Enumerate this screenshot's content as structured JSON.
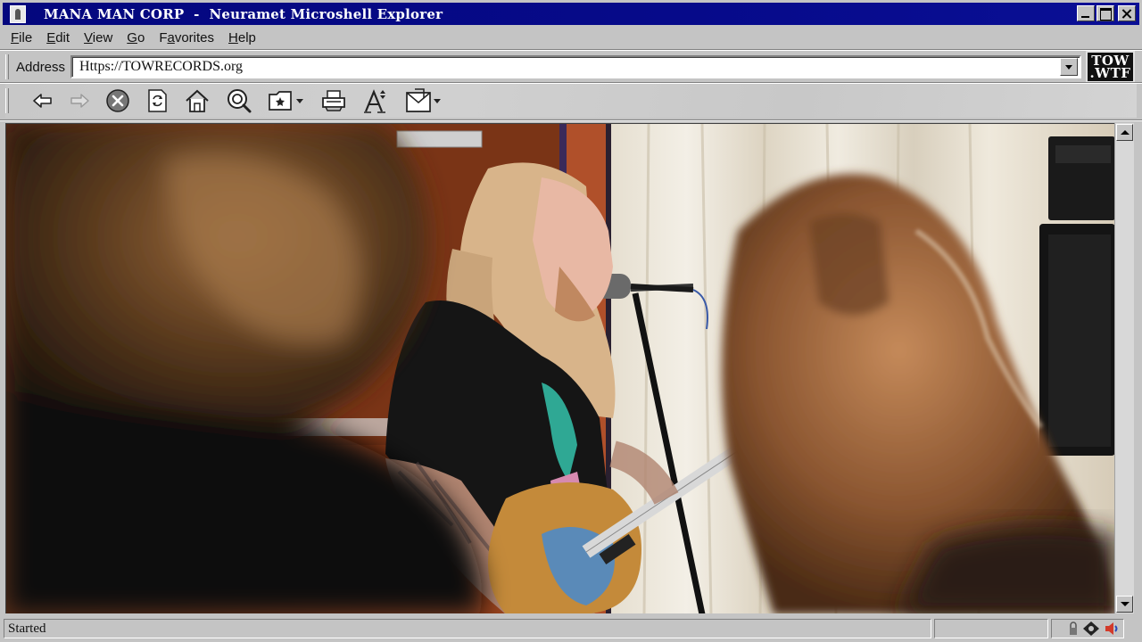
{
  "window": {
    "title": "MANA MAN CORP  -  Neuramet Microshell Explorer"
  },
  "menu": [
    {
      "label_u": "F",
      "label_rest": "ile"
    },
    {
      "label_u": "E",
      "label_rest": "dit"
    },
    {
      "label_u": "V",
      "label_rest": "iew"
    },
    {
      "label_u": "G",
      "label_rest": "o"
    },
    {
      "label_pre": "F",
      "label_u": "a",
      "label_rest": "vorites"
    },
    {
      "label_u": "H",
      "label_rest": "elp"
    }
  ],
  "address": {
    "label": "Address",
    "value": "Https://TOWRECORDS.org"
  },
  "logo": {
    "line1": "TOW",
    "line2": ".WTF"
  },
  "toolbar": {
    "icons": [
      "back-arrow-icon",
      "forward-arrow-icon",
      "stop-icon",
      "refresh-icon",
      "home-icon",
      "search-icon",
      "favorites-folder-icon",
      "print-icon",
      "font-size-icon",
      "mail-icon"
    ]
  },
  "status": {
    "text": "Started"
  },
  "colors": {
    "title_bar": "#04077e",
    "chrome": "#c4c4c4"
  }
}
